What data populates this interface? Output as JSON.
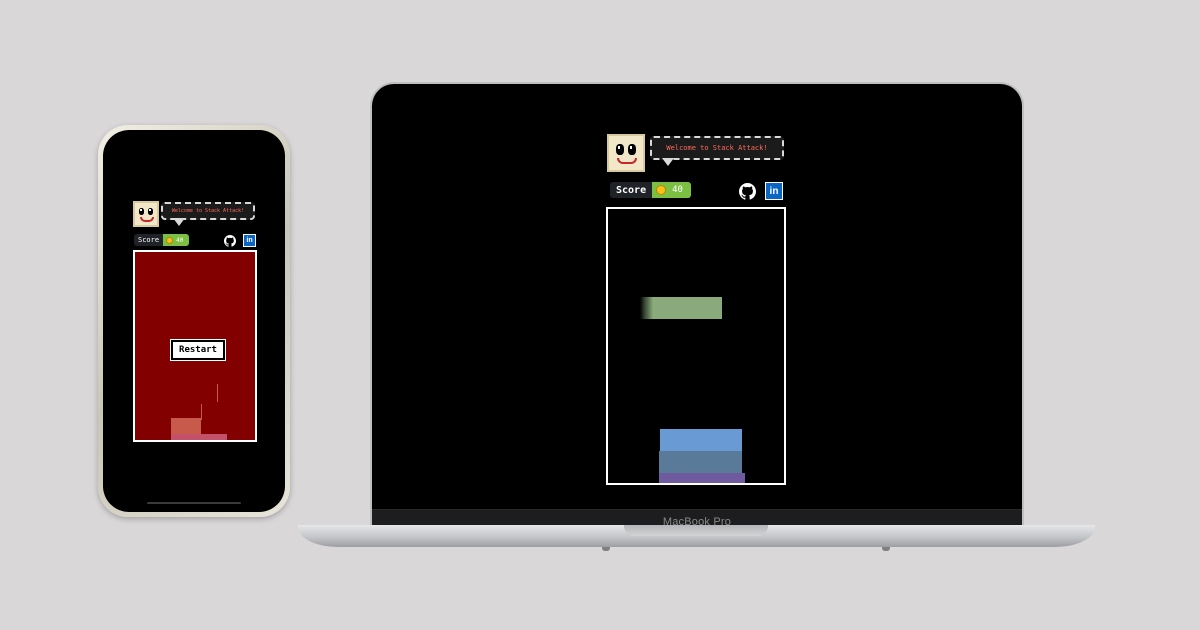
{
  "game": {
    "welcome_text": "Welcome to Stack Attack!",
    "score_label": "Score",
    "laptop_score": "40",
    "phone_score": "40",
    "restart_label": "Restart"
  },
  "device": {
    "laptop_brand": "MacBook Pro"
  },
  "icons": {
    "github": "github-icon",
    "linkedin": "linkedin-icon",
    "linkedin_text": "in",
    "coin": "coin-icon"
  },
  "colors": {
    "background": "#d9d7d8",
    "score_green": "#7cc043",
    "bubble_text": "#ff6b5b",
    "game_over_board": "#820000",
    "moving_block": "#8aaa7c",
    "stack_top": "#6a9ad4",
    "stack_mid": "#5a7a9a",
    "stack_base": "#6f5aa0"
  }
}
